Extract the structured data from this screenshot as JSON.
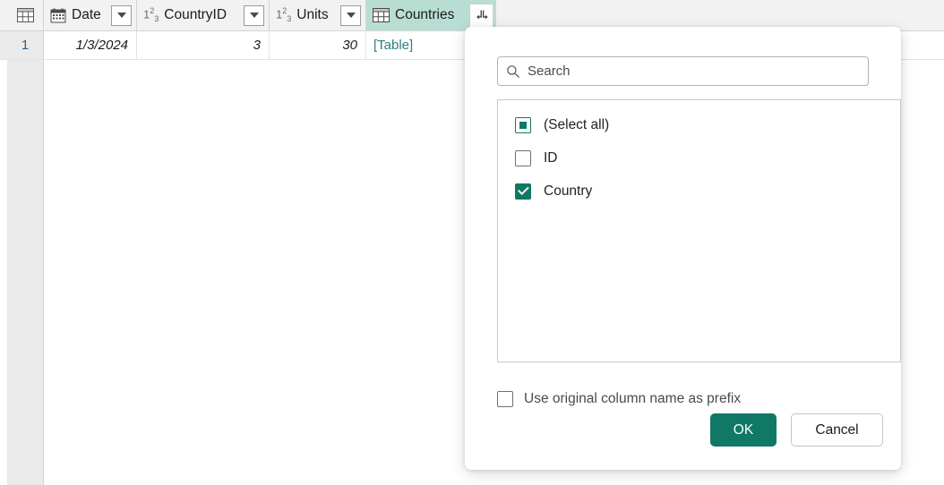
{
  "colors": {
    "accent_green": "#117865",
    "highlight_column": "#b8ded3",
    "link_teal": "#2e8080",
    "gutter_gray": "#eaeaea",
    "header_gray": "#f2f2f2"
  },
  "grid": {
    "select_all_corner_icon": "table-icon",
    "columns": [
      {
        "name": "Date",
        "type_icon": "calendar-icon",
        "has_filter": true,
        "has_expand": false,
        "highlighted": false
      },
      {
        "name": "CountryID",
        "type_icon": "number-123-icon",
        "has_filter": true,
        "has_expand": false,
        "highlighted": false
      },
      {
        "name": "Units",
        "type_icon": "number-123-icon",
        "has_filter": true,
        "has_expand": false,
        "highlighted": false
      },
      {
        "name": "Countries",
        "type_icon": "table-icon",
        "has_filter": false,
        "has_expand": true,
        "highlighted": true
      }
    ],
    "rows": [
      {
        "number": "1",
        "date": "1/3/2024",
        "country_id": "3",
        "units": "30",
        "countries": "[Table]"
      }
    ]
  },
  "dialog": {
    "name": "expand-columns-popup",
    "search": {
      "placeholder": "Search",
      "value": "",
      "icon": "search-icon"
    },
    "list": [
      {
        "label": "(Select all)",
        "state": "indeterminate"
      },
      {
        "label": "ID",
        "state": "unchecked"
      },
      {
        "label": "Country",
        "state": "checked"
      }
    ],
    "prefix_option": {
      "label": "Use original column name as prefix",
      "state": "unchecked"
    },
    "buttons": {
      "ok": "OK",
      "cancel": "Cancel"
    }
  }
}
